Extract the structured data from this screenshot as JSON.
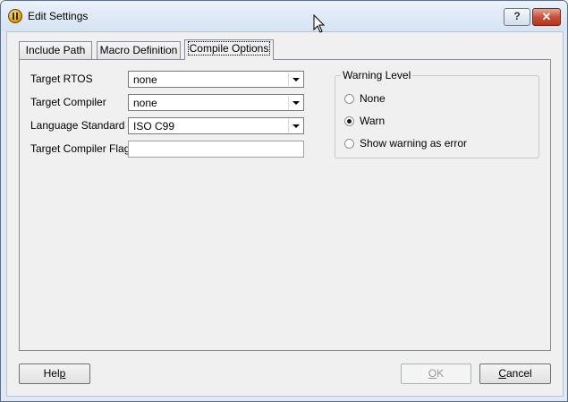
{
  "window": {
    "title": "Edit Settings",
    "help_glyph": "?",
    "close_glyph": "✕",
    "app_icon": "app-logo-icon"
  },
  "tabs": [
    {
      "label": "Include Path",
      "active": false
    },
    {
      "label": "Macro Definition",
      "active": false
    },
    {
      "label": "Compile Options",
      "active": true
    }
  ],
  "fields": {
    "target_rtos": {
      "label": "Target RTOS",
      "value": "none"
    },
    "target_compiler": {
      "label": "Target Compiler",
      "value": "none"
    },
    "language_standard": {
      "label": "Language Standard",
      "value": "ISO C99"
    },
    "target_compiler_flags": {
      "label": "Target Compiler Flags",
      "value": ""
    }
  },
  "warning_level": {
    "title": "Warning Level",
    "options": [
      {
        "label": "None",
        "checked": false
      },
      {
        "label": "Warn",
        "checked": true
      },
      {
        "label": "Show warning as error",
        "checked": false
      }
    ]
  },
  "buttons": {
    "help": {
      "pre": "Hel",
      "mnemonic": "p",
      "post": ""
    },
    "ok": {
      "pre": "",
      "mnemonic": "O",
      "post": "K"
    },
    "cancel": {
      "pre": "",
      "mnemonic": "C",
      "post": "ancel"
    }
  }
}
